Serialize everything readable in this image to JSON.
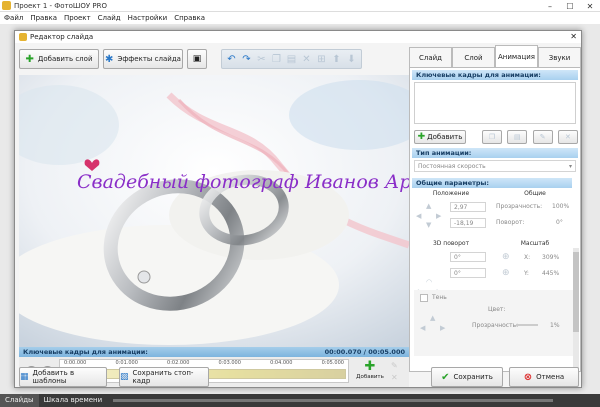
{
  "window": {
    "title": "Проект 1 - ФотоШОУ PRO",
    "controls": [
      "–",
      "☐",
      "✕"
    ]
  },
  "menu": [
    "Файл",
    "Правка",
    "Проект",
    "Слайд",
    "Настройки",
    "Справка"
  ],
  "bottom_tabs": [
    "Слайды",
    "Шкала времени"
  ],
  "dialog": {
    "title": "Редактор слайда",
    "close": "✕",
    "toolbar": {
      "add_layer": "Добавить слой",
      "effects": "Эффекты слайда"
    },
    "preview": {
      "caption": "Свадебный фотограф Иванов Артем"
    },
    "timeline": {
      "header": "Ключевые кадры для анимации:",
      "time": "00:00.070 / 00:05.000",
      "ticks": [
        "0:00.000",
        "0:01.000",
        "0:02.000",
        "0:03.000",
        "0:04.000",
        "0:05.000"
      ],
      "add_label": "Добавить"
    },
    "tabs": [
      "Слайд",
      "Слой",
      "Анимация",
      "Звуки"
    ],
    "active_tab": "Анимация",
    "animation": {
      "keyframes_header": "Ключевые кадры для анимации:",
      "add_button": "Добавить",
      "type_header": "Тип анимации:",
      "type_value": "Постоянная скорость",
      "params_header": "Общие параметры:",
      "position_label": "Положение",
      "position_x": "2,97",
      "position_y": "-18,19",
      "general_label": "Общие",
      "opacity_label": "Прозрачность:",
      "opacity_value": "100%",
      "rotation_label": "Поворот:",
      "rotation_value": "0°",
      "rotate3d_label": "3D поворот",
      "rotate3d_x": "0°",
      "rotate3d_y": "0°",
      "scale_label": "Масштаб",
      "scale_x_label": "X:",
      "scale_x": "309%",
      "scale_y_label": "Y:",
      "scale_y": "445%",
      "shadow_label": "Тень",
      "color_label": "Цвет:",
      "shadow_opacity_label": "Прозрачность:",
      "shadow_opacity_value": "1%"
    },
    "bottom": {
      "add_templates": "Добавить в шаблоны",
      "save_frame": "Сохранить стоп-кадр",
      "save": "Сохранить",
      "cancel": "Отмена"
    }
  },
  "colors": {
    "accent_blue": "#8ec3ea",
    "caption_purple": "#8a2ec8",
    "save_green": "#2aa32a",
    "cancel_red": "#d33333"
  }
}
